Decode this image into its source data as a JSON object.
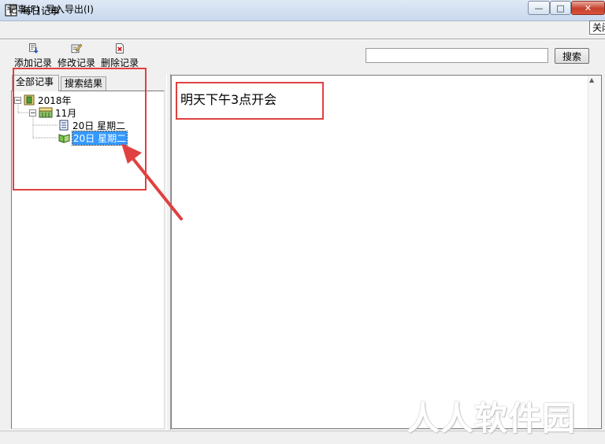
{
  "window": {
    "title": "每日记事",
    "controls": {
      "minimize": "—",
      "maximize": "□",
      "close": "✕"
    },
    "tooltip": "关闭"
  },
  "menu": {
    "items": [
      "记事(F)",
      "导入导出(I)"
    ]
  },
  "toolbar": {
    "add_label": "添加记录",
    "edit_label": "修改记录",
    "delete_label": "删除记录",
    "search_value": "",
    "search_button": "搜索"
  },
  "tabs": {
    "all": "全部记事",
    "results": "搜索结果"
  },
  "tree": {
    "year": "2018年",
    "month": "11月",
    "entries": [
      "20日 星期二",
      "20日 星期二"
    ],
    "toggle_expanded": "−"
  },
  "note": {
    "content": "明天下午3点开会"
  },
  "watermark": "人人软件园",
  "colors": {
    "selection": "#3399ff",
    "annotation": "#e04040"
  }
}
